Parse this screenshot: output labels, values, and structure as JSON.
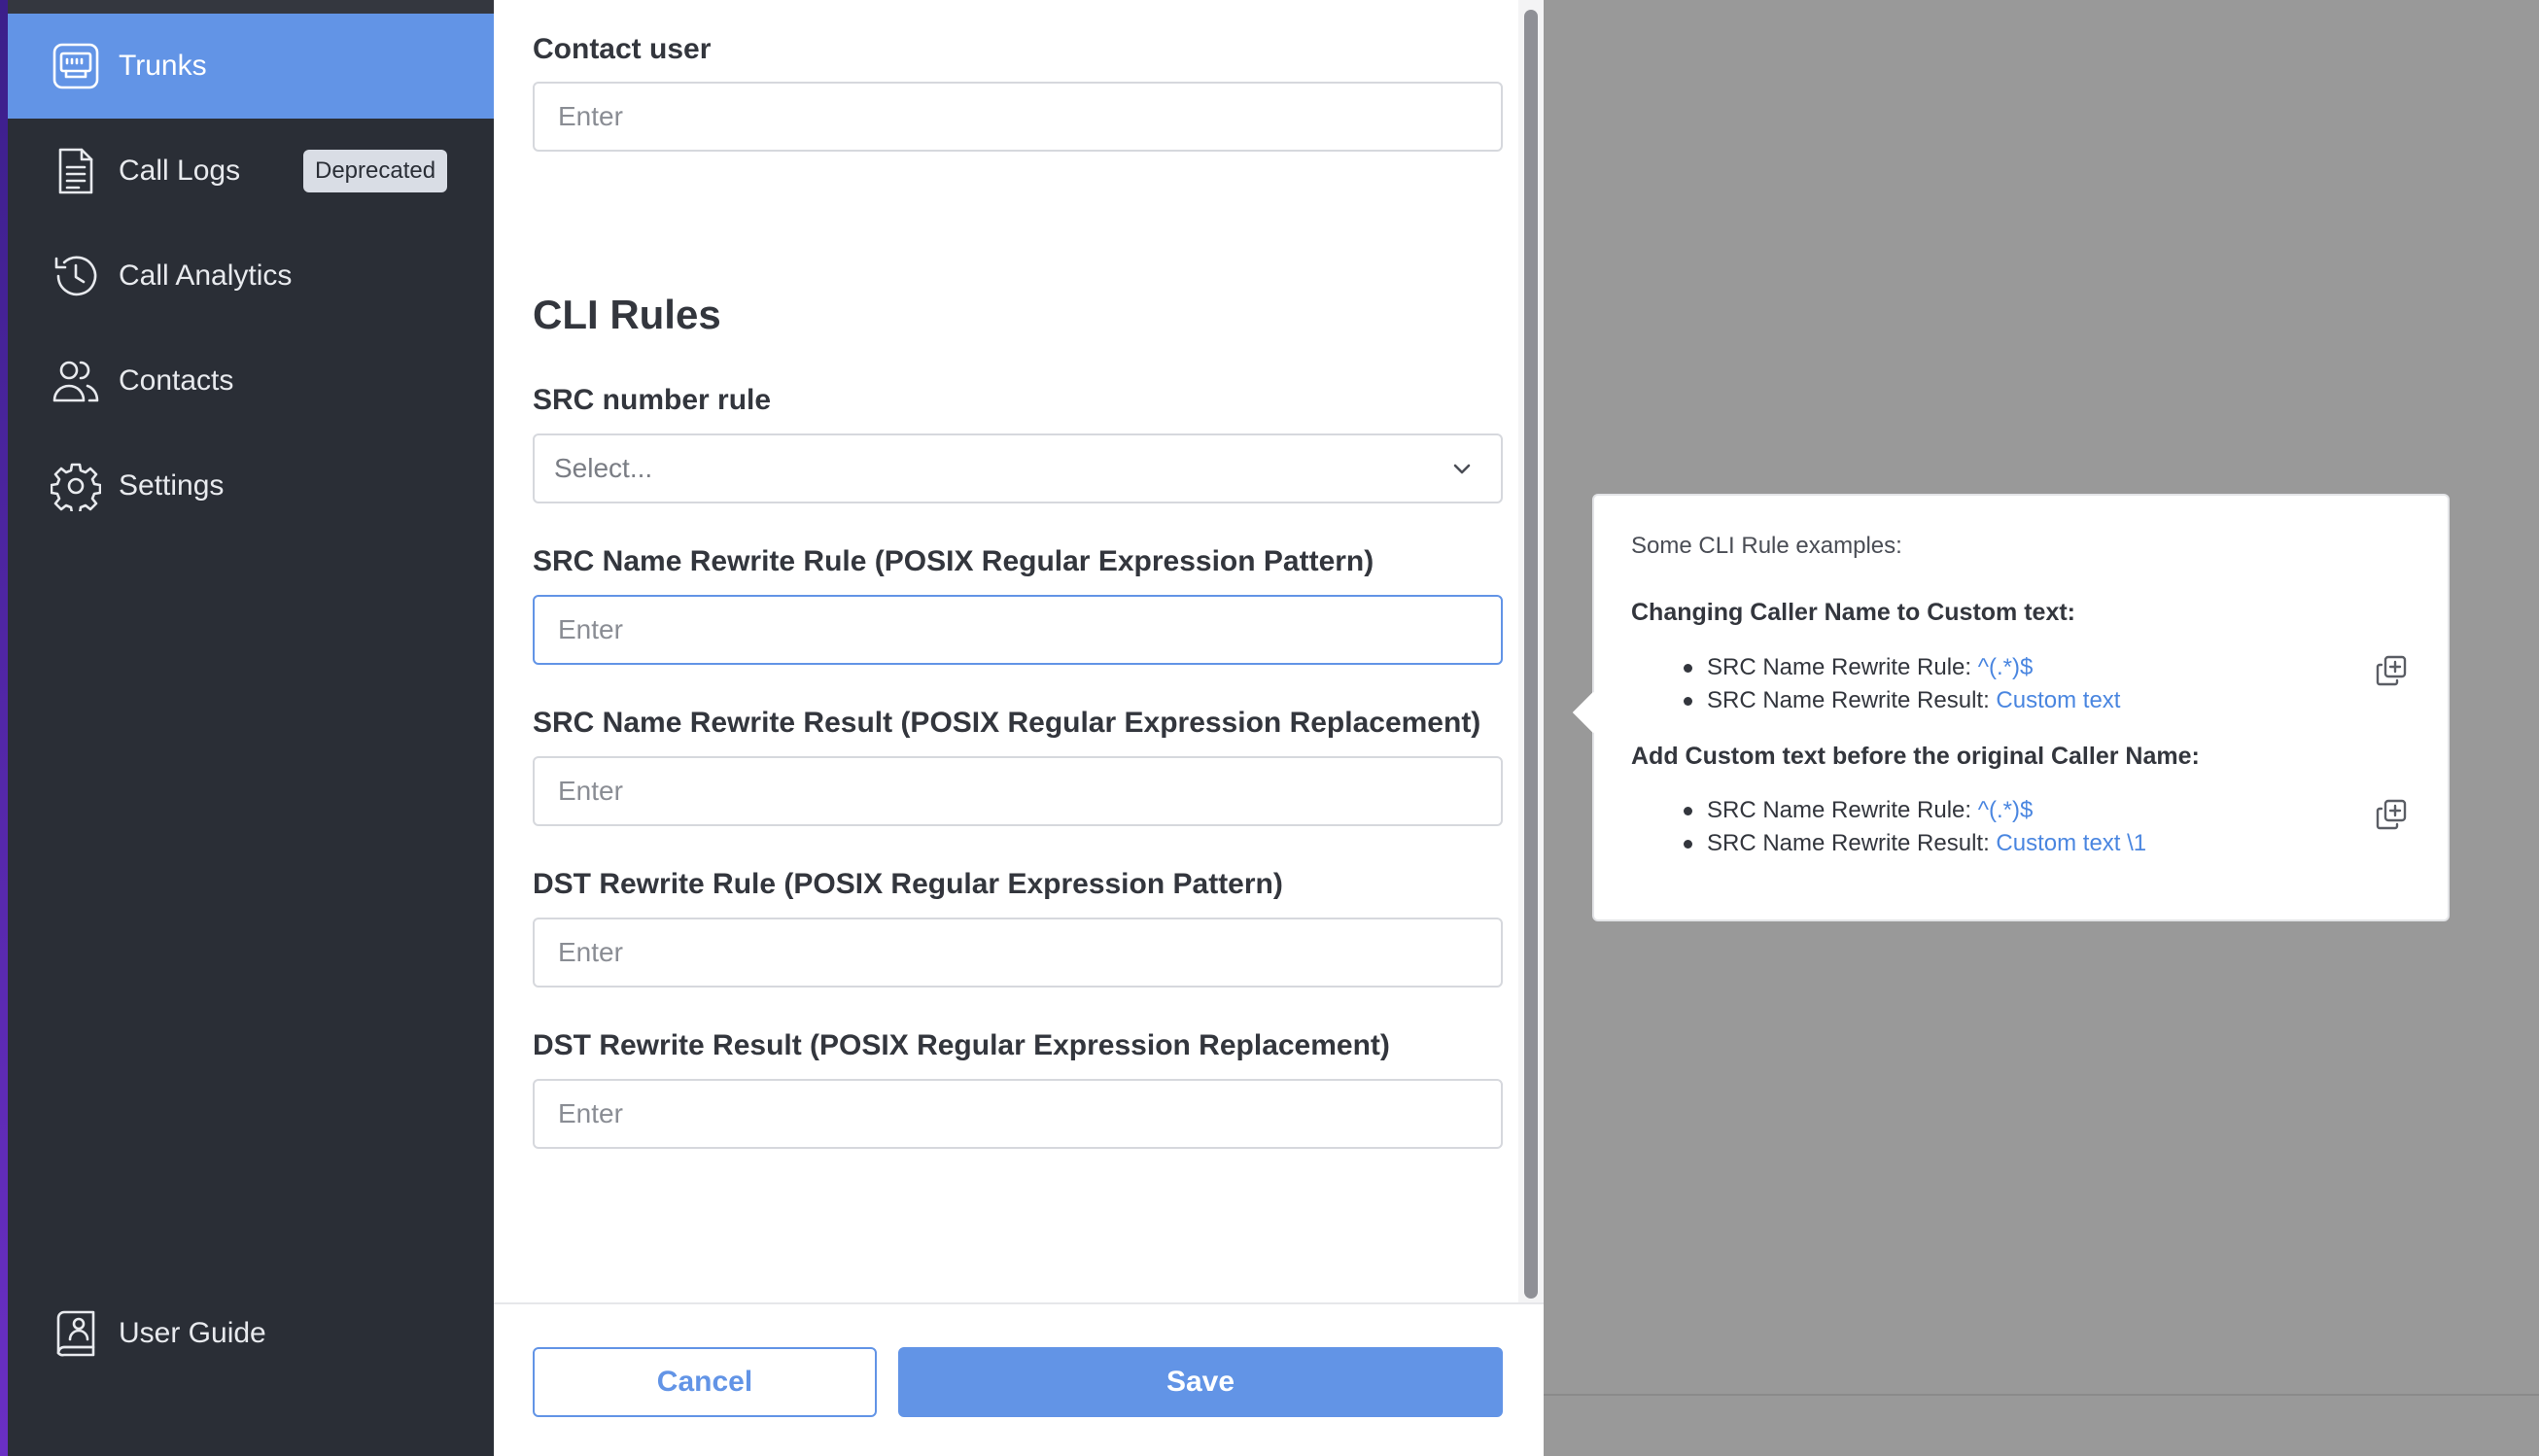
{
  "sidebar": {
    "items": [
      {
        "label": "Trunks",
        "icon": "trunk-icon",
        "active": true
      },
      {
        "label": "Call Logs",
        "icon": "document-icon",
        "badge": "Deprecated"
      },
      {
        "label": "Call Analytics",
        "icon": "history-clock-icon"
      },
      {
        "label": "Contacts",
        "icon": "users-icon"
      },
      {
        "label": "Settings",
        "icon": "gear-icon"
      }
    ],
    "footer_item": {
      "label": "User Guide",
      "icon": "user-guide-icon"
    }
  },
  "form": {
    "contact_user": {
      "label": "Contact user",
      "placeholder": "Enter",
      "value": ""
    },
    "section_title": "CLI Rules",
    "src_number_rule": {
      "label": "SRC number rule",
      "placeholder": "Select..."
    },
    "src_name_rewrite_rule": {
      "label": "SRC Name Rewrite Rule (POSIX Regular Expression Pattern)",
      "placeholder": "Enter",
      "value": ""
    },
    "src_name_rewrite_result": {
      "label": "SRC Name Rewrite Result (POSIX Regular Expression Replacement)",
      "placeholder": "Enter",
      "value": ""
    },
    "dst_rewrite_rule": {
      "label": "DST Rewrite Rule (POSIX Regular Expression Pattern)",
      "placeholder": "Enter",
      "value": ""
    },
    "dst_rewrite_result": {
      "label": "DST Rewrite Result (POSIX Regular Expression Replacement)",
      "placeholder": "Enter",
      "value": ""
    }
  },
  "footer": {
    "cancel_label": "Cancel",
    "save_label": "Save"
  },
  "tooltip": {
    "intro": "Some CLI Rule examples:",
    "examples": [
      {
        "heading": "Changing Caller Name to Custom text:",
        "rule_label": "SRC Name Rewrite Rule: ",
        "rule_value": "^(.*)$",
        "result_label": "SRC Name Rewrite Result: ",
        "result_value": "Custom text"
      },
      {
        "heading": "Add Custom text before the original Caller Name:",
        "rule_label": "SRC Name Rewrite Rule: ",
        "rule_value": "^(.*)$",
        "result_label": "SRC Name Rewrite Result: ",
        "result_value": "Custom text \\1"
      }
    ]
  },
  "colors": {
    "accent": "#6294e6",
    "sidebar_bg": "#2a2e36",
    "overlay": "#999999",
    "link": "#4a86e0"
  }
}
